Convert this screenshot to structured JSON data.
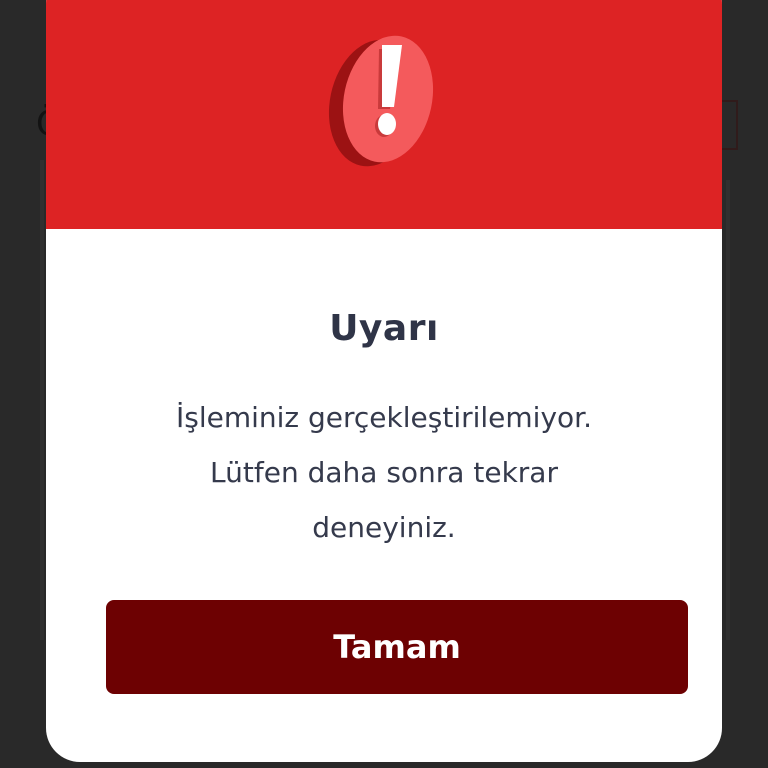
{
  "dialog": {
    "icon": "exclamation-alert-icon",
    "title": "Uyarı",
    "message_lines": [
      "İşleminiz gerçekleştirilemiyor.",
      "Lütfen daha sonra tekrar",
      "deneyiniz."
    ],
    "ok_label": "Tamam"
  },
  "background": {
    "partial_letter": "Ö"
  },
  "colors": {
    "header_red": "#dd2324",
    "button_dark_red": "#6d0102",
    "text_dark": "#2f3447",
    "overlay": "#3f3f3f"
  }
}
